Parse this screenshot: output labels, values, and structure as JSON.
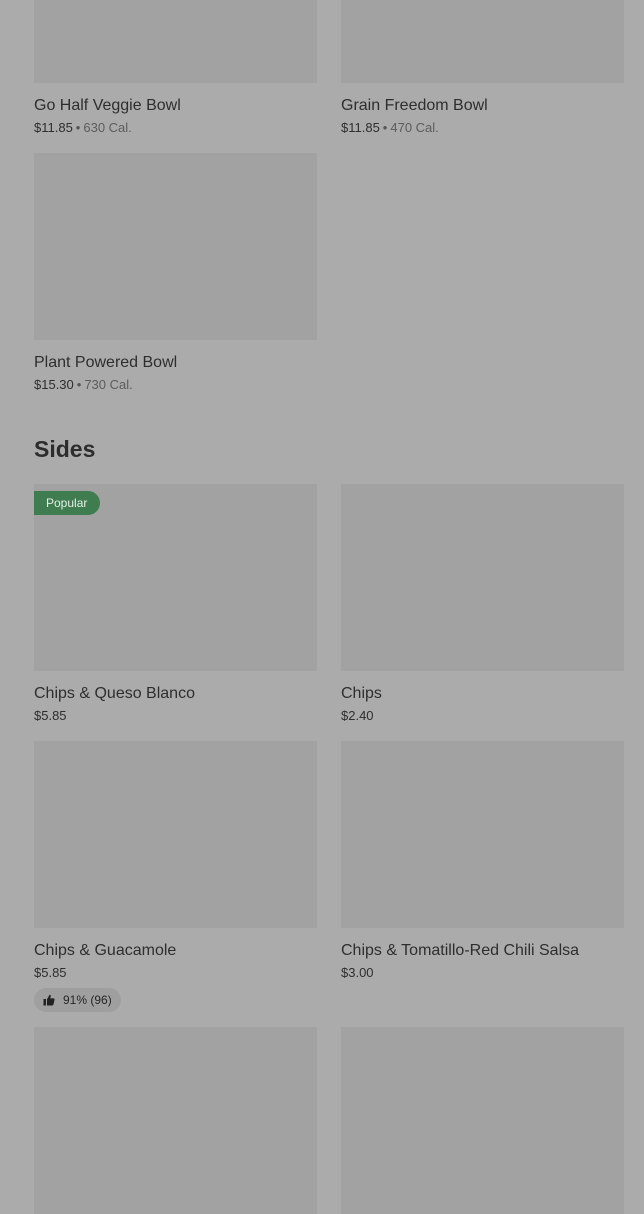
{
  "bowls": [
    {
      "name": "Go Half Veggie Bowl",
      "price": "$11.85",
      "sep": "•",
      "cal": "630 Cal."
    },
    {
      "name": "Grain Freedom Bowl",
      "price": "$11.85",
      "sep": "•",
      "cal": "470 Cal."
    },
    {
      "name": "Plant Powered Bowl",
      "price": "$15.30",
      "sep": "•",
      "cal": "730 Cal."
    }
  ],
  "sides": {
    "title": "Sides",
    "items": [
      {
        "name": "Chips & Queso Blanco",
        "price": "$5.85",
        "badge": "Popular"
      },
      {
        "name": "Chips",
        "price": "$2.40"
      },
      {
        "name": "Chips & Guacamole",
        "price": "$5.85",
        "rating": "91% (96)",
        "rating_icon": "thumbs-up-icon"
      },
      {
        "name": "Chips & Tomatillo-Red Chili Salsa",
        "price": "$3.00"
      }
    ]
  },
  "colors": {
    "background": "#ababab",
    "image_placeholder": "#a2a2a2",
    "popular_badge": "#3f7c50"
  }
}
